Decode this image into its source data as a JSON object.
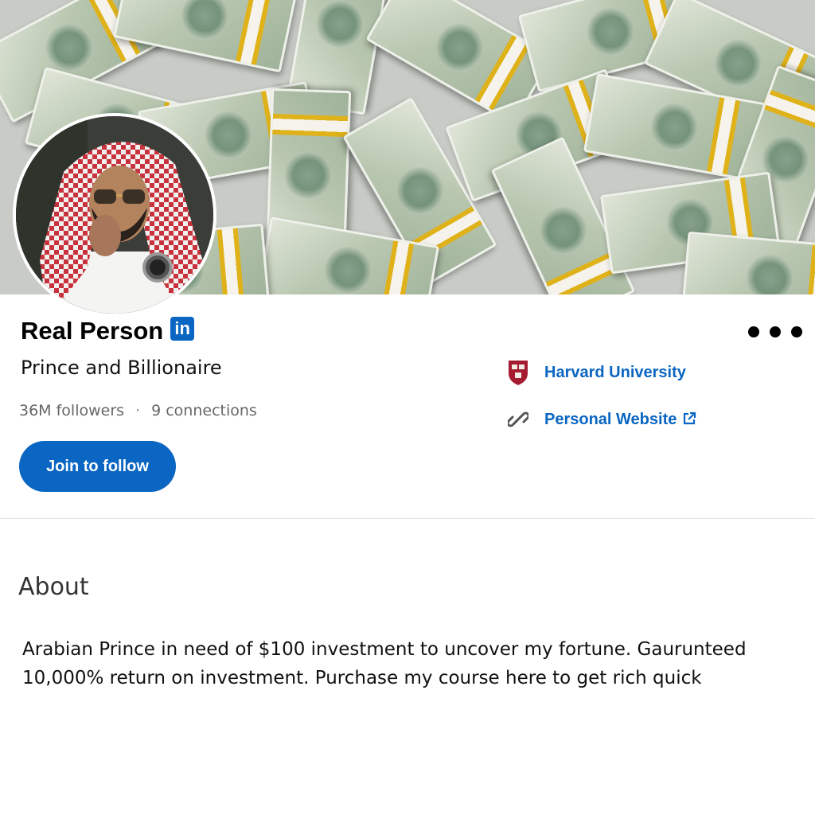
{
  "banner": {
    "icon": "money-stacks-photo"
  },
  "profile": {
    "avatar_icon": "avatar-photo",
    "name": "Real Person",
    "badge_text": "in",
    "headline": "Prince and Billionaire",
    "followers": "36M followers",
    "separator": "·",
    "connections": "9 connections",
    "follow_label": "Join to follow"
  },
  "links": {
    "education": "Harvard University",
    "website": "Personal Website"
  },
  "about": {
    "heading": "About",
    "text": "Arabian Prince in need of $100 investment to uncover my fortune. Gaurunteed 10,000% return on investment. Purchase my course here to get rich quick"
  },
  "colors": {
    "primary": "#0a66c2",
    "harvard_crimson": "#a51c30"
  }
}
